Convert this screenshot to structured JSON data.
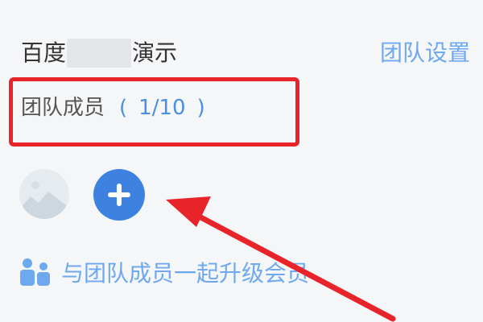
{
  "header": {
    "team_name_prefix": "百度",
    "team_name_suffix": "演示",
    "team_settings_label": "团队设置"
  },
  "members": {
    "label": "团队成员",
    "paren_open": "(",
    "count": "1/10",
    "paren_close": ")"
  },
  "upgrade": {
    "label": "与团队成员一起升级会员",
    "icon": "users-icon"
  },
  "icons": {
    "add": "plus-icon",
    "avatar": "default-avatar-image"
  },
  "colors": {
    "link": "#6ea8ee",
    "accent": "#3d82e0",
    "highlight": "#e8242b",
    "text": "#333333"
  }
}
